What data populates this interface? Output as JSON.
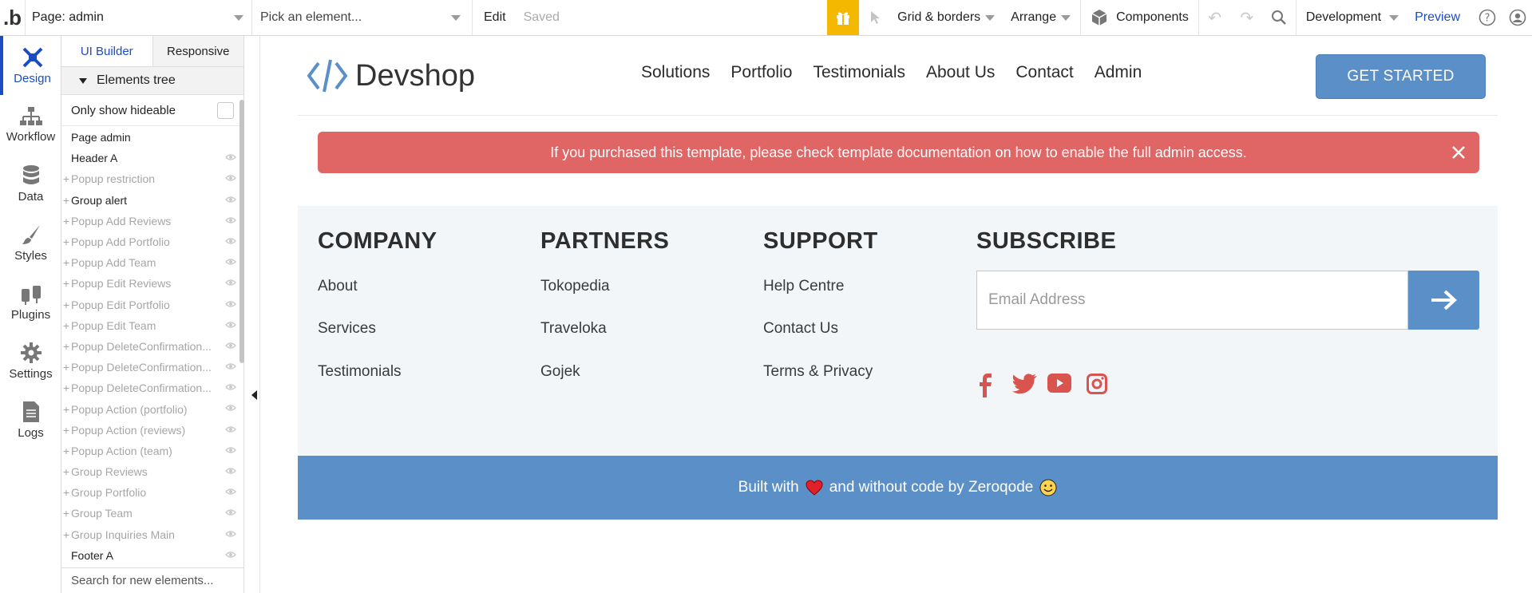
{
  "toolbar": {
    "logo": ".b",
    "page_select": "Page: admin",
    "element_select": "Pick an element...",
    "edit_label": "Edit",
    "saved_label": "Saved",
    "grid_label": "Grid & borders",
    "arrange_label": "Arrange",
    "components_label": "Components",
    "version_label": "Development",
    "preview_label": "Preview"
  },
  "leftnav": {
    "items": [
      {
        "label": "Design",
        "icon": "design-icon"
      },
      {
        "label": "Workflow",
        "icon": "workflow-icon"
      },
      {
        "label": "Data",
        "icon": "data-icon"
      },
      {
        "label": "Styles",
        "icon": "styles-icon"
      },
      {
        "label": "Plugins",
        "icon": "plugins-icon"
      },
      {
        "label": "Settings",
        "icon": "settings-icon"
      },
      {
        "label": "Logs",
        "icon": "logs-icon"
      }
    ]
  },
  "panel": {
    "tabs": [
      "UI Builder",
      "Responsive"
    ],
    "tree_title": "Elements tree",
    "only_hideable": "Only show hideable",
    "search_placeholder": "Search for new elements...",
    "items": [
      {
        "label": "Page admin",
        "faded": false,
        "plus": false,
        "eye": false
      },
      {
        "label": "Header A",
        "faded": false,
        "plus": false,
        "eye": true
      },
      {
        "label": "Popup restriction",
        "faded": true,
        "plus": true,
        "eye": true
      },
      {
        "label": "Group alert",
        "faded": false,
        "plus": true,
        "eye": true
      },
      {
        "label": "Popup Add Reviews",
        "faded": true,
        "plus": true,
        "eye": true
      },
      {
        "label": "Popup Add Portfolio",
        "faded": true,
        "plus": true,
        "eye": true
      },
      {
        "label": "Popup Add Team",
        "faded": true,
        "plus": true,
        "eye": true
      },
      {
        "label": "Popup Edit Reviews",
        "faded": true,
        "plus": true,
        "eye": true
      },
      {
        "label": "Popup Edit Portfolio",
        "faded": true,
        "plus": true,
        "eye": true
      },
      {
        "label": "Popup Edit Team",
        "faded": true,
        "plus": true,
        "eye": true
      },
      {
        "label": "Popup DeleteConfirmation...",
        "faded": true,
        "plus": true,
        "eye": true
      },
      {
        "label": "Popup DeleteConfirmation...",
        "faded": true,
        "plus": true,
        "eye": true
      },
      {
        "label": "Popup DeleteConfirmation...",
        "faded": true,
        "plus": true,
        "eye": true
      },
      {
        "label": "Popup Action (portfolio)",
        "faded": true,
        "plus": true,
        "eye": true
      },
      {
        "label": "Popup Action (reviews)",
        "faded": true,
        "plus": true,
        "eye": true
      },
      {
        "label": "Popup Action (team)",
        "faded": true,
        "plus": true,
        "eye": true
      },
      {
        "label": "Group Reviews",
        "faded": true,
        "plus": true,
        "eye": true
      },
      {
        "label": "Group Portfolio",
        "faded": true,
        "plus": true,
        "eye": true
      },
      {
        "label": "Group Team",
        "faded": true,
        "plus": true,
        "eye": true
      },
      {
        "label": "Group Inquiries Main",
        "faded": true,
        "plus": true,
        "eye": true
      },
      {
        "label": "Footer A",
        "faded": false,
        "plus": false,
        "eye": true
      }
    ]
  },
  "site": {
    "brand": "Devshop",
    "nav": [
      "Solutions",
      "Portfolio",
      "Testimonials",
      "About Us",
      "Contact",
      "Admin"
    ],
    "cta": "GET STARTED",
    "alert": "If you purchased this template, please check template documentation on how to enable the full admin access.",
    "footer": {
      "company": {
        "title": "COMPANY",
        "links": [
          "About",
          "Services",
          "Testimonials"
        ]
      },
      "partners": {
        "title": "PARTNERS",
        "links": [
          "Tokopedia",
          "Traveloka",
          "Gojek"
        ]
      },
      "support": {
        "title": "SUPPORT",
        "links": [
          "Help Centre",
          "Contact Us",
          "Terms & Privacy"
        ]
      },
      "subscribe": {
        "title": "SUBSCRIBE",
        "email_placeholder": "Email Address"
      },
      "social": [
        "facebook-icon",
        "twitter-icon",
        "youtube-icon",
        "instagram-icon"
      ],
      "credit_before": "Built with",
      "credit_after": "and without code by Zeroqode"
    }
  },
  "colors": {
    "accent": "#1b4cc6",
    "brand_blue": "#5b8fc7",
    "alert_red": "#e06565",
    "gift_yellow": "#f5b800",
    "social_red": "#d9534f"
  }
}
